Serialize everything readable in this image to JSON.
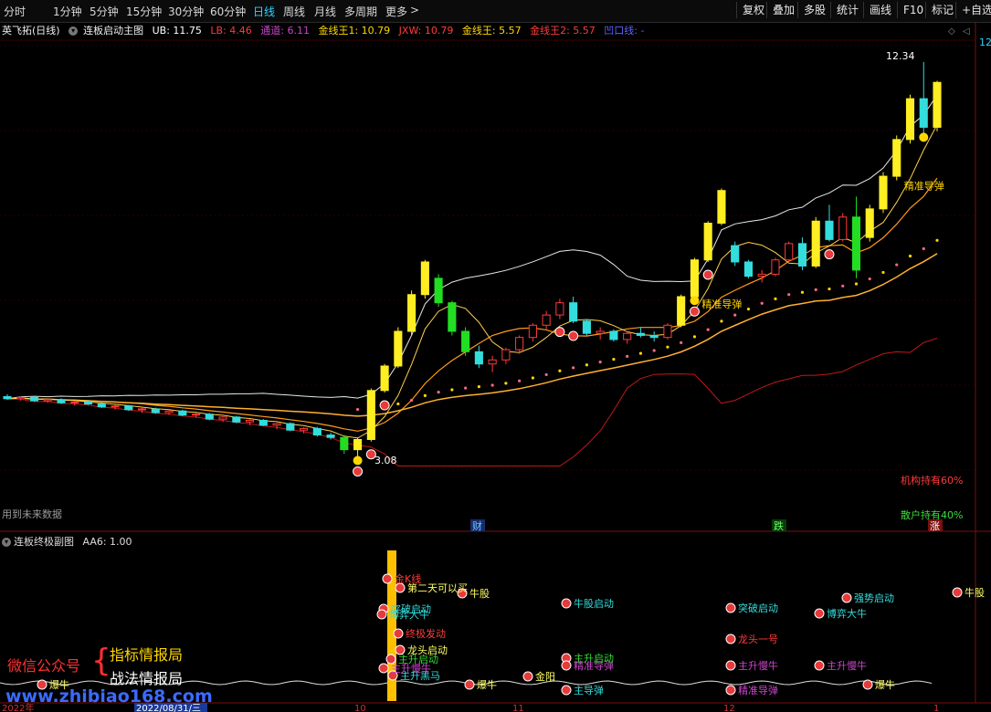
{
  "toolbar": {
    "periods": [
      "分时",
      "1分钟",
      "5分钟",
      "15分钟",
      "30分钟",
      "60分钟",
      "日线",
      "周线",
      "月线",
      "多周期",
      "更多"
    ],
    "active_period": "日线",
    "tools": [
      "复权",
      "叠加",
      "多股",
      "统计",
      "画线",
      "F10",
      "标记",
      "+自选"
    ]
  },
  "main_panel": {
    "stock": "英飞拓(日线)",
    "indicator": "连板启动主图",
    "legend": [
      {
        "label": "UB: 11.75",
        "color": "#ffffff"
      },
      {
        "label": "LB: 4.46",
        "color": "#ff3b3b"
      },
      {
        "label": "通道: 6.11",
        "color": "#cc44cc"
      },
      {
        "label": "金线王1: 10.79",
        "color": "#ffd700"
      },
      {
        "label": "JXW: 10.79",
        "color": "#ff3b3b"
      },
      {
        "label": "金线王: 5.57",
        "color": "#ffd700"
      },
      {
        "label": "金线王2: 5.57",
        "color": "#ff3b3b"
      },
      {
        "label": "凹口线: -",
        "color": "#6060ff"
      }
    ],
    "price_high_label": "12.34",
    "price_low_label": "3.08",
    "left_note": "用到未来数据",
    "holding": [
      {
        "label": "机构持有60%",
        "color": "#ff3b3b"
      },
      {
        "label": "散户持有40%",
        "color": "#3bdc3b"
      }
    ],
    "event_markers": [
      "财",
      "跌",
      "涨"
    ],
    "signals": [
      {
        "text": "精准导弹",
        "bar": 51
      },
      {
        "text": "精准导弹",
        "bar": 66
      }
    ],
    "axis_top_value": "12"
  },
  "sub_panel": {
    "indicator": "连板终极副图",
    "legend": "AA6: 1.00",
    "labels": [
      {
        "text": "金K线",
        "color": "#ff3b3b",
        "x": 432,
        "y": 638
      },
      {
        "text": "第二天可以买",
        "color": "#ffff66",
        "x": 446,
        "y": 648
      },
      {
        "text": "牛股",
        "color": "#ffff66",
        "x": 514,
        "y": 654
      },
      {
        "text": "突破启动",
        "color": "#33dddd",
        "x": 428,
        "y": 671
      },
      {
        "text": "博弈大牛",
        "color": "#33dddd",
        "x": 426,
        "y": 677
      },
      {
        "text": "终极发动",
        "color": "#ff3b3b",
        "x": 444,
        "y": 698
      },
      {
        "text": "龙头启动",
        "color": "#ffff66",
        "x": 446,
        "y": 716
      },
      {
        "text": "主升启动",
        "color": "#33dd33",
        "x": 436,
        "y": 726
      },
      {
        "text": "主升慢牛",
        "color": "#cc44cc",
        "x": 428,
        "y": 736
      },
      {
        "text": "主升黑马",
        "color": "#33dddd",
        "x": 438,
        "y": 744
      },
      {
        "text": "爆牛",
        "color": "#ffff66",
        "x": 54,
        "y": 754
      },
      {
        "text": "爆牛",
        "color": "#ffff66",
        "x": 522,
        "y": 754
      },
      {
        "text": "金阳",
        "color": "#ffff66",
        "x": 586,
        "y": 745
      },
      {
        "text": "牛股启动",
        "color": "#33dddd",
        "x": 628,
        "y": 665
      },
      {
        "text": "主升启动",
        "color": "#33dd33",
        "x": 628,
        "y": 725
      },
      {
        "text": "精准导弹",
        "color": "#cc44cc",
        "x": 628,
        "y": 733
      },
      {
        "text": "主导弹",
        "color": "#33dddd",
        "x": 628,
        "y": 760
      },
      {
        "text": "突破启动",
        "color": "#33dddd",
        "x": 808,
        "y": 670
      },
      {
        "text": "龙头一号",
        "color": "#ff3b3b",
        "x": 808,
        "y": 704
      },
      {
        "text": "主升慢牛",
        "color": "#cc44cc",
        "x": 808,
        "y": 733
      },
      {
        "text": "精准导弹",
        "color": "#cc44cc",
        "x": 808,
        "y": 760
      },
      {
        "text": "强势启动",
        "color": "#33dddd",
        "x": 935,
        "y": 659
      },
      {
        "text": "博弈大牛",
        "color": "#33dddd",
        "x": 905,
        "y": 676
      },
      {
        "text": "主升慢牛",
        "color": "#cc44cc",
        "x": 905,
        "y": 733
      },
      {
        "text": "爆牛",
        "color": "#ffff66",
        "x": 958,
        "y": 754
      },
      {
        "text": "牛股",
        "color": "#ffff66",
        "x": 1056,
        "y": 653
      }
    ]
  },
  "x_axis": {
    "labels": [
      "2022年",
      "2022/08/31/三",
      "10",
      "11",
      "12",
      "1"
    ]
  },
  "watermark": {
    "account_label": "微信公众号",
    "lines": [
      "指标情报局",
      "战法情报局"
    ],
    "url": "www.zhibiao168.com"
  },
  "chart_data": {
    "type": "candlestick",
    "ylim": [
      2.8,
      13.2
    ],
    "x": [
      "b1",
      "b2",
      "b3",
      "b4",
      "b5",
      "b6",
      "b7",
      "b8",
      "b9",
      "b10",
      "b11",
      "b12",
      "b13",
      "b14",
      "b15",
      "b16",
      "b17",
      "b18",
      "b19",
      "b20",
      "b21",
      "b22",
      "b23",
      "b24",
      "b25",
      "b26",
      "b27",
      "b28",
      "b29",
      "b30",
      "b31",
      "b32",
      "b33",
      "b34",
      "b35",
      "b36",
      "b37",
      "b38",
      "b39",
      "b40",
      "b41",
      "b42",
      "b43",
      "b44",
      "b45",
      "b46",
      "b47",
      "b48",
      "b49",
      "b50",
      "b51",
      "b52",
      "b53",
      "b54",
      "b55",
      "b56",
      "b57",
      "b58",
      "b59",
      "b60",
      "b61",
      "b62",
      "b63",
      "b64",
      "b65",
      "b66",
      "b67",
      "b68",
      "b69",
      "b70"
    ],
    "ohlc": [
      [
        4.6,
        4.66,
        4.52,
        4.55
      ],
      [
        4.55,
        4.6,
        4.5,
        4.58
      ],
      [
        4.58,
        4.62,
        4.48,
        4.5
      ],
      [
        4.5,
        4.55,
        4.45,
        4.53
      ],
      [
        4.53,
        4.56,
        4.42,
        4.45
      ],
      [
        4.45,
        4.5,
        4.38,
        4.47
      ],
      [
        4.47,
        4.52,
        4.4,
        4.42
      ],
      [
        4.42,
        4.46,
        4.32,
        4.35
      ],
      [
        4.35,
        4.4,
        4.28,
        4.37
      ],
      [
        4.37,
        4.4,
        4.25,
        4.28
      ],
      [
        4.28,
        4.34,
        4.2,
        4.3
      ],
      [
        4.3,
        4.33,
        4.18,
        4.21
      ],
      [
        4.21,
        4.28,
        4.15,
        4.25
      ],
      [
        4.25,
        4.28,
        4.12,
        4.15
      ],
      [
        4.15,
        4.2,
        4.08,
        4.17
      ],
      [
        4.17,
        4.2,
        4.02,
        4.05
      ],
      [
        4.05,
        4.12,
        3.98,
        4.1
      ],
      [
        4.1,
        4.13,
        3.95,
        3.98
      ],
      [
        3.98,
        4.05,
        3.9,
        4.02
      ],
      [
        4.02,
        4.05,
        3.88,
        3.9
      ],
      [
        3.9,
        3.96,
        3.8,
        3.94
      ],
      [
        3.94,
        3.97,
        3.75,
        3.78
      ],
      [
        3.78,
        3.85,
        3.7,
        3.82
      ],
      [
        3.82,
        3.86,
        3.62,
        3.66
      ],
      [
        3.66,
        3.72,
        3.55,
        3.6
      ],
      [
        3.6,
        3.66,
        3.2,
        3.3
      ],
      [
        3.3,
        3.6,
        3.08,
        3.55
      ],
      [
        3.55,
        4.8,
        3.5,
        4.75
      ],
      [
        4.75,
        5.4,
        4.7,
        5.35
      ],
      [
        5.35,
        6.3,
        5.3,
        6.2
      ],
      [
        6.2,
        7.2,
        6.1,
        7.1
      ],
      [
        7.1,
        7.95,
        7.0,
        7.9
      ],
      [
        7.5,
        7.6,
        6.8,
        6.9
      ],
      [
        6.9,
        6.95,
        6.1,
        6.2
      ],
      [
        6.2,
        6.3,
        5.6,
        5.7
      ],
      [
        5.7,
        5.85,
        5.3,
        5.4
      ],
      [
        5.4,
        5.6,
        5.2,
        5.5
      ],
      [
        5.5,
        5.8,
        5.4,
        5.75
      ],
      [
        5.75,
        6.1,
        5.65,
        6.05
      ],
      [
        6.05,
        6.4,
        5.95,
        6.35
      ],
      [
        6.35,
        6.7,
        6.25,
        6.6
      ],
      [
        6.6,
        7.0,
        6.5,
        6.9
      ],
      [
        6.9,
        7.05,
        6.4,
        6.45
      ],
      [
        6.45,
        6.5,
        6.1,
        6.15
      ],
      [
        6.15,
        6.3,
        6.0,
        6.2
      ],
      [
        6.2,
        6.25,
        5.95,
        6.0
      ],
      [
        6.0,
        6.2,
        5.9,
        6.15
      ],
      [
        6.15,
        6.3,
        6.05,
        6.1
      ],
      [
        6.1,
        6.2,
        5.95,
        6.05
      ],
      [
        6.05,
        6.4,
        6.0,
        6.35
      ],
      [
        6.35,
        7.1,
        6.3,
        7.05
      ],
      [
        7.05,
        8.0,
        7.0,
        7.95
      ],
      [
        7.95,
        8.9,
        7.9,
        8.85
      ],
      [
        8.85,
        9.7,
        8.8,
        9.65
      ],
      [
        8.3,
        8.4,
        7.8,
        7.9
      ],
      [
        7.9,
        7.95,
        7.5,
        7.55
      ],
      [
        7.55,
        7.7,
        7.4,
        7.6
      ],
      [
        7.6,
        8.0,
        7.55,
        7.95
      ],
      [
        7.95,
        8.4,
        7.9,
        8.35
      ],
      [
        8.35,
        8.5,
        7.7,
        7.8
      ],
      [
        7.8,
        9.0,
        7.75,
        8.9
      ],
      [
        8.9,
        9.3,
        8.4,
        8.45
      ],
      [
        8.45,
        9.1,
        8.4,
        9.0
      ],
      [
        9.0,
        9.5,
        7.5,
        7.7
      ],
      [
        8.5,
        9.3,
        8.4,
        9.2
      ],
      [
        9.2,
        10.1,
        9.1,
        10.0
      ],
      [
        10.0,
        11.0,
        9.9,
        10.9
      ],
      [
        10.9,
        12.0,
        10.8,
        11.9
      ],
      [
        11.9,
        12.8,
        11.0,
        11.2
      ],
      [
        11.2,
        12.34,
        11.1,
        12.3
      ]
    ]
  }
}
